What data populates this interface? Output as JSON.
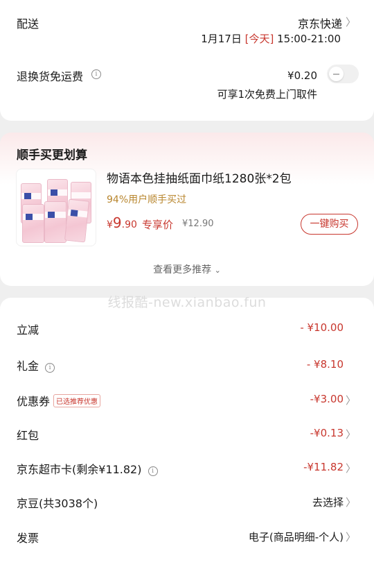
{
  "delivery": {
    "label": "配送",
    "method": "京东快递",
    "date": "1月17日",
    "today": "[今天]",
    "time_range": "15:00-21:00"
  },
  "return_shipping": {
    "label": "退换货免运费",
    "price": "¥0.20",
    "note": "可享1次免费上门取件",
    "toggle_on": false
  },
  "promo": {
    "title": "顺手买更划算",
    "product": {
      "title": "物语本色挂抽纸面巾纸1280张*2包",
      "social_proof": "94%用户顺手买过",
      "price_symbol": "¥",
      "price_int": "9",
      "price_dec": ".90",
      "price_tag": "专享价",
      "original_price": "¥12.90",
      "buy_label": "一键购买"
    },
    "more_label": "查看更多推荐"
  },
  "watermark": "线报酷-new.xianbao.fun",
  "summary": {
    "rows": [
      {
        "label": "立减",
        "value": "- ¥10.00"
      },
      {
        "label": "礼金",
        "value": "- ¥8.10"
      },
      {
        "label": "优惠券",
        "badge": "已选推荐优惠",
        "value": "-¥3.00"
      },
      {
        "label": "红包",
        "value": "-¥0.13"
      },
      {
        "label": "京东超市卡(剩余¥11.82)",
        "value": "-¥11.82"
      },
      {
        "label": "京豆(共3038个)",
        "value": "去选择"
      },
      {
        "label": "发票",
        "value": "电子(商品明细-个人)"
      }
    ]
  },
  "colors": {
    "accent_red": "#c8372e",
    "gold": "#b8862e"
  }
}
